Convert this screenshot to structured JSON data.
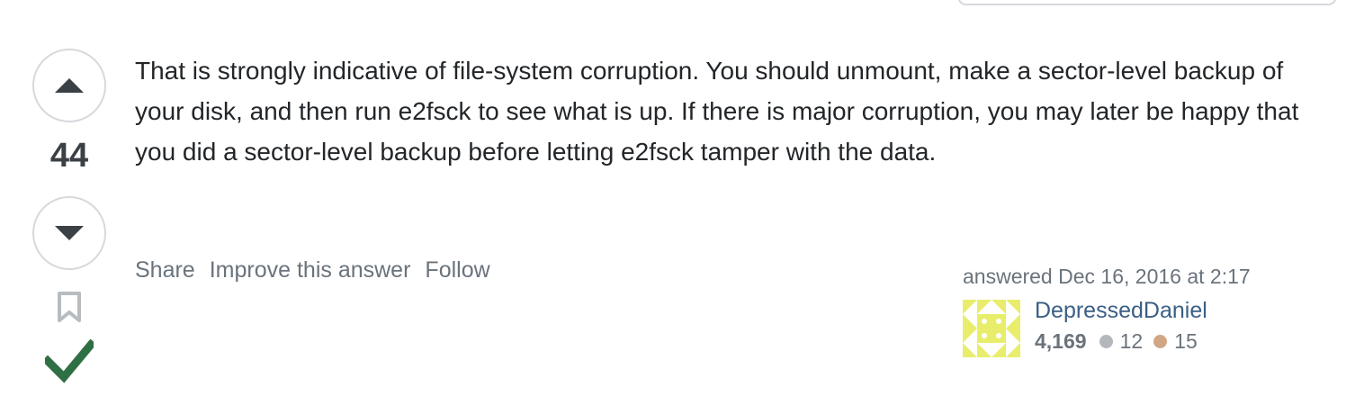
{
  "vote": {
    "count": "44"
  },
  "answer": {
    "body": "That is strongly indicative of file-system corruption. You should unmount, make a sector-level backup of your disk, and then run e2fsck to see what is up. If there is major corruption, you may later be happy that you did a sector-level backup before letting e2fsck tamper with the data."
  },
  "menu": {
    "share": "Share",
    "improve": "Improve this answer",
    "follow": "Follow"
  },
  "user_card": {
    "answered": "answered Dec 16, 2016 at 2:17",
    "name": "DepressedDaniel",
    "reputation": "4,169",
    "silver_badges": "12",
    "bronze_badges": "15"
  },
  "colors": {
    "accepted_check": "#2f6f44",
    "silver_badge": "#b4b8bc",
    "bronze_badge": "#d1a684",
    "avatar_fill": "#e8ee6b",
    "user_link": "#3b5f85"
  },
  "icons": {
    "upvote": "caret-up-icon",
    "downvote": "caret-down-icon",
    "bookmark": "bookmark-icon",
    "accepted": "checkmark-icon",
    "avatar": "identicon"
  }
}
